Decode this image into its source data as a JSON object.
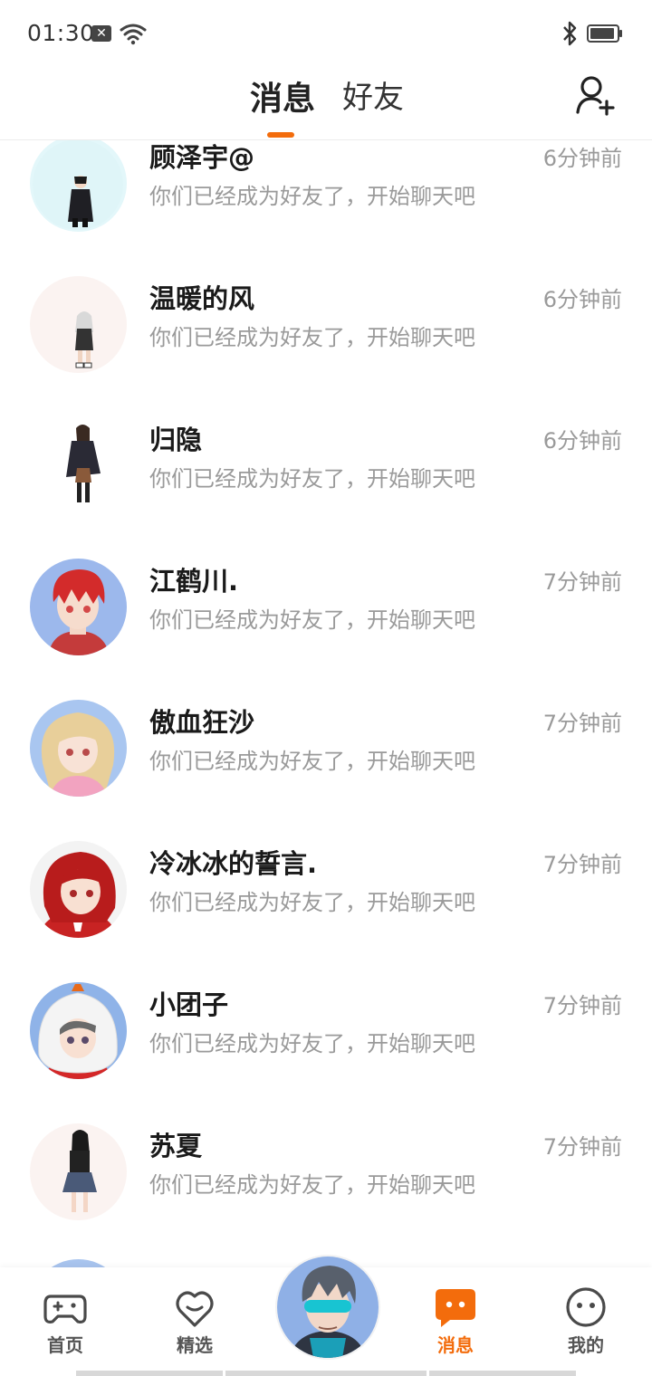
{
  "status_bar": {
    "time": "01:30",
    "notification_icon": "x-close-icon",
    "wifi_icon": "wifi-icon",
    "bluetooth_icon": "bluetooth-icon",
    "battery_icon": "battery-icon"
  },
  "header": {
    "tabs": [
      {
        "label": "消息",
        "active": true
      },
      {
        "label": "好友",
        "active": false
      }
    ],
    "add_friend_icon": "add-user-icon",
    "accent_color": "#f36c0c"
  },
  "conversations": [
    {
      "name": "顾泽宇@",
      "preview": "你们已经成为好友了，开始聊天吧",
      "time": "6分钟前",
      "avatar": "avatar-boy-black-outfit"
    },
    {
      "name": "温暖的风",
      "preview": "你们已经成为好友了，开始聊天吧",
      "time": "6分钟前",
      "avatar": "avatar-girl-white-hair"
    },
    {
      "name": "归隐",
      "preview": "你们已经成为好友了，开始聊天吧",
      "time": "6分钟前",
      "avatar": "avatar-girl-dark-coat"
    },
    {
      "name": "江鹤川.",
      "preview": "你们已经成为好友了，开始聊天吧",
      "time": "7分钟前",
      "avatar": "avatar-red-hair-boy"
    },
    {
      "name": "傲血狂沙",
      "preview": "你们已经成为好友了，开始聊天吧",
      "time": "7分钟前",
      "avatar": "avatar-blonde-girl"
    },
    {
      "name": "冷冰冰的誓言.",
      "preview": "你们已经成为好友了，开始聊天吧",
      "time": "7分钟前",
      "avatar": "avatar-red-hair-girl"
    },
    {
      "name": "小团子",
      "preview": "你们已经成为好友了，开始聊天吧",
      "time": "7分钟前",
      "avatar": "avatar-hooded-girl"
    },
    {
      "name": "苏夏",
      "preview": "你们已经成为好友了，开始聊天吧",
      "time": "7分钟前",
      "avatar": "avatar-girl-phone"
    }
  ],
  "bottom_nav": {
    "items": [
      {
        "label": "首页",
        "icon": "gamepad-icon",
        "active": false
      },
      {
        "label": "精选",
        "icon": "heart-chat-icon",
        "active": false
      },
      {
        "label": "消息",
        "icon": "message-bubble-icon",
        "active": true
      },
      {
        "label": "我的",
        "icon": "face-icon",
        "active": false
      }
    ],
    "center_avatar": "avatar-visor-boy"
  }
}
